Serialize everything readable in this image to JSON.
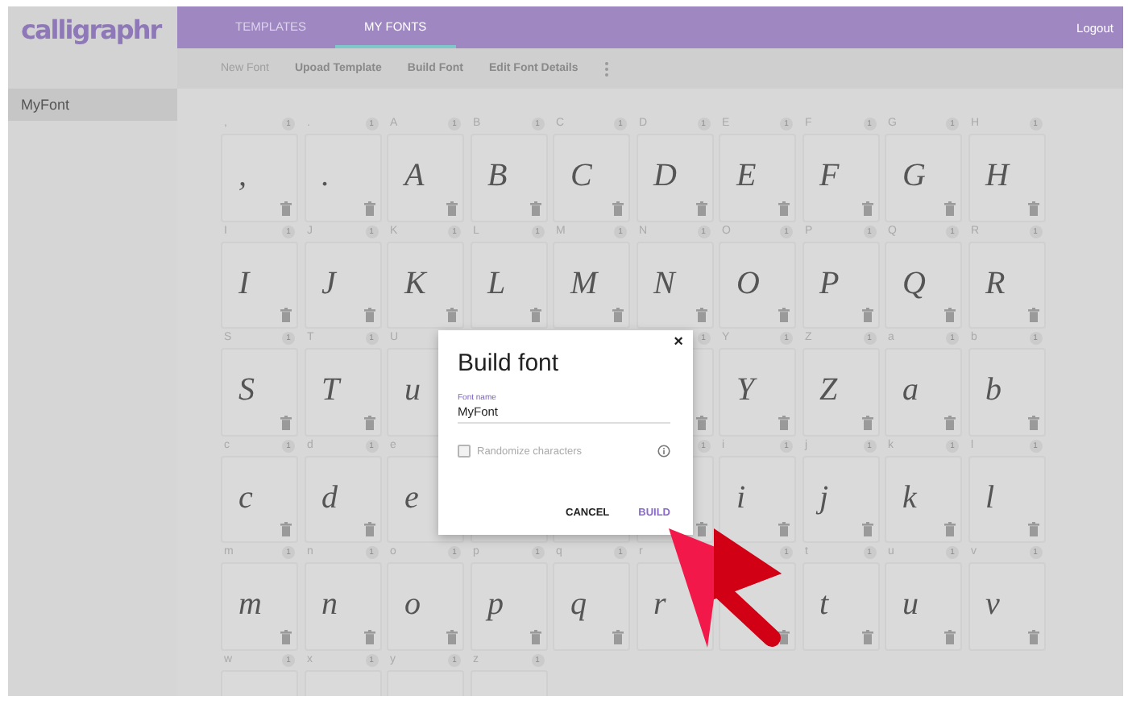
{
  "logo": {
    "text": "calligraphr"
  },
  "tabs": [
    {
      "label": "TEMPLATES",
      "selected": false
    },
    {
      "label": "MY FONTS",
      "selected": true
    }
  ],
  "logout": "Logout",
  "toolbar": [
    {
      "label": "New Font",
      "disabled": true
    },
    {
      "label": "Upoad Template",
      "disabled": false
    },
    {
      "label": "Build Font",
      "disabled": false
    },
    {
      "label": "Edit Font Details",
      "disabled": false
    }
  ],
  "sidebar": {
    "items": [
      {
        "label": "MyFont",
        "selected": true
      }
    ]
  },
  "glyph_grid": {
    "rows": [
      [
        {
          "label": ",",
          "count": "1",
          "glyph": ","
        },
        {
          "label": ".",
          "count": "1",
          "glyph": "."
        },
        {
          "label": "A",
          "count": "1",
          "glyph": "A"
        },
        {
          "label": "B",
          "count": "1",
          "glyph": "B"
        },
        {
          "label": "C",
          "count": "1",
          "glyph": "C"
        },
        {
          "label": "D",
          "count": "1",
          "glyph": "D"
        },
        {
          "label": "E",
          "count": "1",
          "glyph": "E"
        },
        {
          "label": "F",
          "count": "1",
          "glyph": "F"
        },
        {
          "label": "G",
          "count": "1",
          "glyph": "G"
        },
        {
          "label": "H",
          "count": "1",
          "glyph": "H"
        }
      ],
      [
        {
          "label": "I",
          "count": "1",
          "glyph": "I"
        },
        {
          "label": "J",
          "count": "1",
          "glyph": "J"
        },
        {
          "label": "K",
          "count": "1",
          "glyph": "K"
        },
        {
          "label": "L",
          "count": "1",
          "glyph": "L"
        },
        {
          "label": "M",
          "count": "1",
          "glyph": "M"
        },
        {
          "label": "N",
          "count": "1",
          "glyph": "N"
        },
        {
          "label": "O",
          "count": "1",
          "glyph": "O"
        },
        {
          "label": "P",
          "count": "1",
          "glyph": "P"
        },
        {
          "label": "Q",
          "count": "1",
          "glyph": "Q"
        },
        {
          "label": "R",
          "count": "1",
          "glyph": "R"
        }
      ],
      [
        {
          "label": "S",
          "count": "1",
          "glyph": "S"
        },
        {
          "label": "T",
          "count": "1",
          "glyph": "T"
        },
        {
          "label": "U",
          "glyph": "u"
        },
        {},
        {},
        {
          "count": "1"
        },
        {
          "label": "Y",
          "count": "1",
          "glyph": "Y"
        },
        {
          "label": "Z",
          "count": "1",
          "glyph": "Z"
        },
        {
          "label": "a",
          "count": "1",
          "glyph": "a"
        },
        {
          "label": "b",
          "count": "1",
          "glyph": "b"
        }
      ],
      [
        {
          "label": "c",
          "count": "1",
          "glyph": "c"
        },
        {
          "label": "d",
          "count": "1",
          "glyph": "d"
        },
        {
          "label": "e",
          "glyph": "e"
        },
        {},
        {},
        {
          "count": "1"
        },
        {
          "label": "i",
          "count": "1",
          "glyph": "i"
        },
        {
          "label": "j",
          "count": "1",
          "glyph": "j"
        },
        {
          "label": "k",
          "count": "1",
          "glyph": "k"
        },
        {
          "label": "l",
          "count": "1",
          "glyph": "l"
        }
      ],
      [
        {
          "label": "m",
          "count": "1",
          "glyph": "m"
        },
        {
          "label": "n",
          "count": "1",
          "glyph": "n"
        },
        {
          "label": "o",
          "count": "1",
          "glyph": "o"
        },
        {
          "label": "p",
          "count": "1",
          "glyph": "p"
        },
        {
          "label": "q",
          "count": "1",
          "glyph": "q"
        },
        {
          "label": "r",
          "glyph": "r"
        },
        {
          "count": "1"
        },
        {
          "label": "t",
          "count": "1",
          "glyph": "t"
        },
        {
          "label": "u",
          "count": "1",
          "glyph": "u"
        },
        {
          "label": "v",
          "count": "1",
          "glyph": "v"
        }
      ],
      [
        {
          "label": "w",
          "count": "1"
        },
        {
          "label": "x",
          "count": "1"
        },
        {
          "label": "y",
          "count": "1"
        },
        {
          "label": "z",
          "count": "1"
        }
      ]
    ]
  },
  "dialog": {
    "title": "Build font",
    "close": "×",
    "field": {
      "label": "Font name",
      "value": "MyFont"
    },
    "checkbox": {
      "label": "Randomize characters",
      "checked": false,
      "disabled": true
    },
    "buttons": [
      {
        "label": "CANCEL",
        "kind": "plain"
      },
      {
        "label": "BUILD",
        "kind": "primary"
      }
    ]
  }
}
